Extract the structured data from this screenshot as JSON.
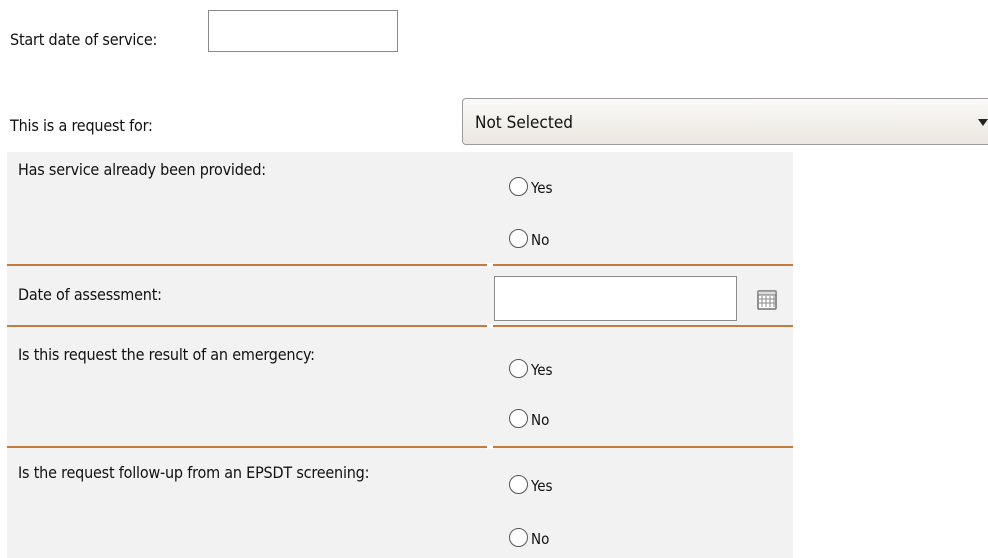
{
  "start_date": {
    "label": "Start date of service:",
    "value": ""
  },
  "request_type": {
    "label": "This is a request for:",
    "selected": "Not Selected"
  },
  "service_provided": {
    "question": "Has service already been provided:",
    "options": [
      "Yes",
      "No"
    ]
  },
  "assessment_date": {
    "label": "Date of assessment:",
    "value": ""
  },
  "emergency": {
    "question": "Is this request the result of an emergency:",
    "options": [
      "Yes",
      "No"
    ]
  },
  "epsdt": {
    "question": "Is the request follow-up from an EPSDT screening:",
    "options": [
      "Yes",
      "No"
    ]
  },
  "icons": {
    "select_arrow": "dropdown-arrow-icon",
    "calendar": "calendar-icon"
  },
  "colors": {
    "divider": "#c57b3b",
    "panel_background": "#f2f2f2",
    "select_top": "#fbfaf7",
    "select_bottom": "#ebe7df"
  }
}
